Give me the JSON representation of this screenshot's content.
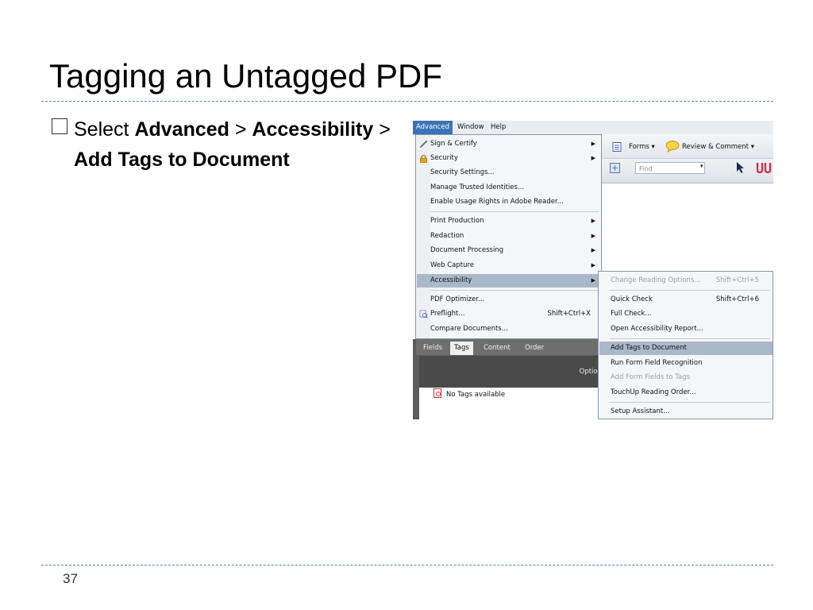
{
  "slide": {
    "title": "Tagging an Untagged PDF",
    "bullet_prefix": "Select ",
    "bullet_bold_1": "Advanced",
    "bullet_sep_1": " > ",
    "bullet_bold_2": "Accessibility",
    "bullet_sep_2": " > ",
    "bullet_bold_3": "Add Tags to Document",
    "page_number": "37"
  },
  "menubar": {
    "advanced": "Advanced",
    "window": "Window",
    "help": "Help"
  },
  "toolbar": {
    "forms": "Forms ▾",
    "review": "Review & Comment ▾",
    "find_placeholder": "Find"
  },
  "advanced_menu": {
    "items": [
      {
        "label": "Sign & Certify",
        "shortcut": ""
      },
      {
        "label": "Security",
        "shortcut": ""
      },
      {
        "label": "Security Settings...",
        "shortcut": ""
      },
      {
        "label": "Manage Trusted Identities...",
        "shortcut": ""
      },
      {
        "label": "Enable Usage Rights in Adobe Reader...",
        "shortcut": ""
      },
      {
        "label": "Print Production",
        "shortcut": ""
      },
      {
        "label": "Redaction",
        "shortcut": ""
      },
      {
        "label": "Document Processing",
        "shortcut": ""
      },
      {
        "label": "Web Capture",
        "shortcut": ""
      },
      {
        "label": "Accessibility",
        "shortcut": ""
      },
      {
        "label": "PDF Optimizer...",
        "shortcut": ""
      },
      {
        "label": "Preflight...",
        "shortcut": "Shift+Ctrl+X"
      },
      {
        "label": "Compare Documents...",
        "shortcut": ""
      }
    ]
  },
  "accessibility_submenu": {
    "items": [
      {
        "label": "Change Reading Options...",
        "shortcut": "Shift+Ctrl+5"
      },
      {
        "label": "Quick Check",
        "shortcut": "Shift+Ctrl+6"
      },
      {
        "label": "Full Check...",
        "shortcut": ""
      },
      {
        "label": "Open Accessibility Report...",
        "shortcut": ""
      },
      {
        "label": "Add Tags to Document",
        "shortcut": ""
      },
      {
        "label": "Run Form Field Recognition",
        "shortcut": ""
      },
      {
        "label": "Add Form Fields to Tags",
        "shortcut": ""
      },
      {
        "label": "TouchUp Reading Order...",
        "shortcut": ""
      },
      {
        "label": "Setup Assistant...",
        "shortcut": ""
      }
    ]
  },
  "panel": {
    "tabs": [
      "Fields",
      "Tags",
      "Content",
      "Order"
    ],
    "options": "Option",
    "empty_message": "No Tags available"
  }
}
